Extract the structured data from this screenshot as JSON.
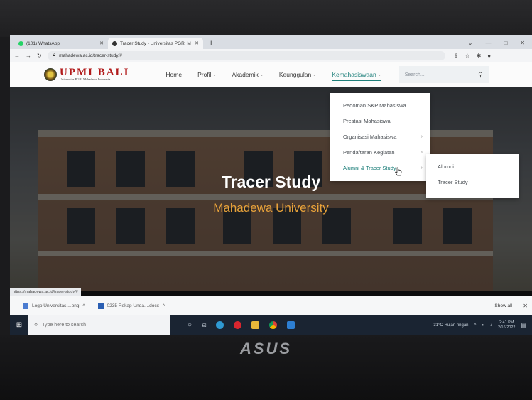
{
  "browser": {
    "tabs": [
      {
        "label": "(101) WhatsApp",
        "favicon_color": "#25d366"
      },
      {
        "label": "Tracer Study - Universitas PGRI M",
        "favicon_color": "#333333"
      }
    ],
    "new_tab": "+",
    "window_controls": [
      "⌄",
      "—",
      "□",
      "✕"
    ],
    "url": "mahadewa.ac.id/tracer-study/#",
    "status_url": "https://mahadewa.ac.id/tracer-study/#"
  },
  "site": {
    "logo": {
      "main": "UPMI BALI",
      "sub": "Universitas PGRI Mahadewa Indonesia"
    },
    "nav": [
      {
        "label": "Home",
        "has_dropdown": false
      },
      {
        "label": "Profil",
        "has_dropdown": true
      },
      {
        "label": "Akademik",
        "has_dropdown": true
      },
      {
        "label": "Keunggulan",
        "has_dropdown": true
      },
      {
        "label": "Kemahasiswaan",
        "has_dropdown": true,
        "active": true
      }
    ],
    "search": {
      "placeholder": "Search..."
    },
    "hero": {
      "title": "Tracer Study",
      "subtitle": "Mahadewa University"
    },
    "dropdown": [
      {
        "label": "Pedoman SKP Mahasiswa",
        "has_sub": false
      },
      {
        "label": "Prestasi Mahasiswa",
        "has_sub": false
      },
      {
        "label": "Organisasi Mahasiswa",
        "has_sub": true
      },
      {
        "label": "Pendaftaran Kegiatan",
        "has_sub": true
      },
      {
        "label": "Alumni & Tracer Study",
        "has_sub": true
      }
    ],
    "submenu": [
      {
        "label": "Alumni"
      },
      {
        "label": "Tracer Study"
      }
    ]
  },
  "downloads": {
    "items": [
      {
        "name": "Logo Universitas....png"
      },
      {
        "name": "0235 Rekap Unda....docx"
      }
    ],
    "show_all": "Show all"
  },
  "taskbar": {
    "search_placeholder": "Type here to search",
    "weather": "31°C  Hujan ringan",
    "time": "2:41 PM",
    "date": "2/16/2022"
  },
  "bezel": {
    "brand": "ASUS"
  },
  "colors": {
    "accent": "#1d7f7a",
    "brand_red": "#b11a1a",
    "hero_subtitle": "#e8a23a"
  }
}
